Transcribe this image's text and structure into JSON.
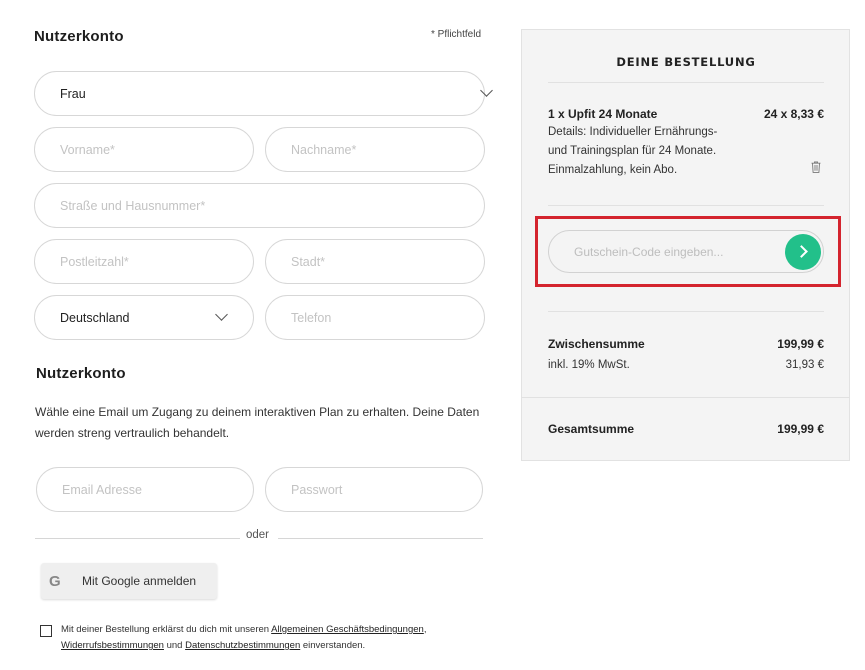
{
  "left": {
    "section1_title": "Nutzerkonto",
    "required_note": "* Pflichtfeld",
    "salutation": {
      "value": "Frau"
    },
    "fields": {
      "firstname": "Vorname*",
      "lastname": "Nachname*",
      "street": "Straße und Hausnummer*",
      "zip": "Postleitzahl*",
      "city": "Stadt*",
      "phone": "Telefon"
    },
    "country": {
      "value": "Deutschland"
    },
    "section2_title": "Nutzerkonto",
    "info_text": "Wähle eine Email um Zugang zu deinem interaktiven Plan zu erhalten. Deine Daten werden streng vertraulich behandelt.",
    "email_placeholder": "Email Adresse",
    "password_placeholder": "Passwort",
    "or_label": "oder",
    "google": {
      "icon": "google-g-icon",
      "letter": "G",
      "label": "Mit Google anmelden"
    },
    "terms": {
      "prefix": "Mit deiner Bestellung erklärst du dich mit unseren ",
      "agb": "Allgemeinen Geschäftsbedingungen",
      "comma": ",",
      "widerruf": "Widerrufsbestimmungen",
      "und": " und ",
      "datenschutz": "Datenschutzbestimmungen",
      "suffix": " einverstanden."
    }
  },
  "order": {
    "title": "DEINE BESTELLUNG",
    "item_name": "1 x Upfit 24 Monate",
    "item_price": "24 x 8,33 €",
    "details_line1": "Details: Individueller Ernährungs-",
    "details_line2": "und Trainingsplan für 24 Monate.",
    "details_line3": "Einmalzahlung, kein Abo.",
    "delete_icon": "trash-icon",
    "coupon_placeholder": "Gutschein-Code eingeben...",
    "coupon_submit_icon": "chevron-right-icon",
    "subtotal_label": "Zwischensumme",
    "subtotal_value": "199,99 €",
    "vat_label": "inkl. 19% MwSt.",
    "vat_value": "31,93 €",
    "total_label": "Gesamtsumme",
    "total_value": "199,99 €"
  },
  "colors": {
    "accent_green": "#22c08a",
    "highlight_red": "#d4242e",
    "panel_bg": "#f4f4f4"
  }
}
